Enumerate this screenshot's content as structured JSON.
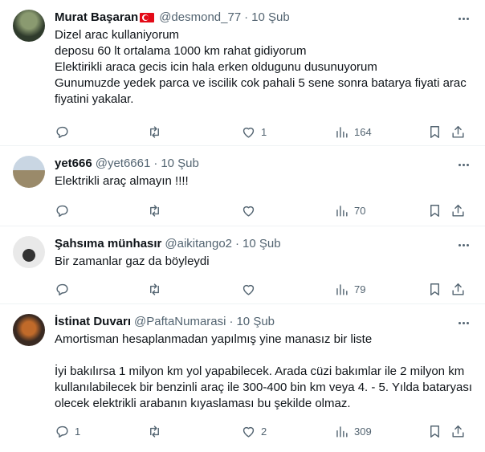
{
  "tweets": [
    {
      "name": "Murat Başaran",
      "flag": "turkey-flag",
      "handle": "@desmond_77",
      "sep": "·",
      "time": "10 Şub",
      "text": "Dizel arac kullaniyorum\ndeposu 60 lt ortalama 1000 km rahat gidiyorum\nElektirikli araca gecis icin hala erken oldugunu dusunuyorum\nGunumuzde yedek parca ve iscilik cok pahali 5 sene sonra batarya fiyati arac fiyatini yakalar.",
      "replies": "",
      "retweets": "",
      "likes": "1",
      "views": "164",
      "avatar_colors": [
        "#2f3b2c",
        "#6b7a5a"
      ]
    },
    {
      "name": "yet666",
      "handle": "@yet6661",
      "sep": "·",
      "time": "10 Şub",
      "text": "Elektrikli araç almayın !!!!",
      "replies": "",
      "retweets": "",
      "likes": "",
      "views": "70",
      "avatar_colors": [
        "#b9c7d6",
        "#8d7a60"
      ]
    },
    {
      "name": "Şahsıma münhasır",
      "handle": "@aikitango2",
      "sep": "·",
      "time": "10 Şub",
      "text": "Bir zamanlar gaz da böyleydi",
      "replies": "",
      "retweets": "",
      "likes": "",
      "views": "79",
      "avatar_colors": [
        "#e9e9e9",
        "#222222"
      ]
    },
    {
      "name": "İstinat Duvarı",
      "handle": "@PaftaNumarasi",
      "sep": "·",
      "time": "10 Şub",
      "text": "Amortisman hesaplanmadan yapılmış yine manasız bir liste\n\nİyi bakılırsa 1 milyon km yol yapabilecek. Arada cüzi bakımlar ile 2 milyon km kullanılabilecek bir benzinli araç ile 300-400 bin km veya 4. - 5. Yılda bataryası olecek elektrikli arabanın kıyaslaması bu şekilde olmaz.",
      "replies": "1",
      "retweets": "",
      "likes": "2",
      "views": "309",
      "avatar_colors": [
        "#3a2a22",
        "#c06a2a"
      ]
    }
  ],
  "icons": {
    "reply": "reply-icon",
    "retweet": "retweet-icon",
    "like": "heart-icon",
    "views": "views-icon",
    "bookmark": "bookmark-icon",
    "share": "share-icon",
    "more": "more-icon"
  },
  "colors": {
    "text": "#0f1419",
    "secondary": "#536471",
    "divider": "#eff3f4",
    "flag_red": "#e30a17"
  }
}
